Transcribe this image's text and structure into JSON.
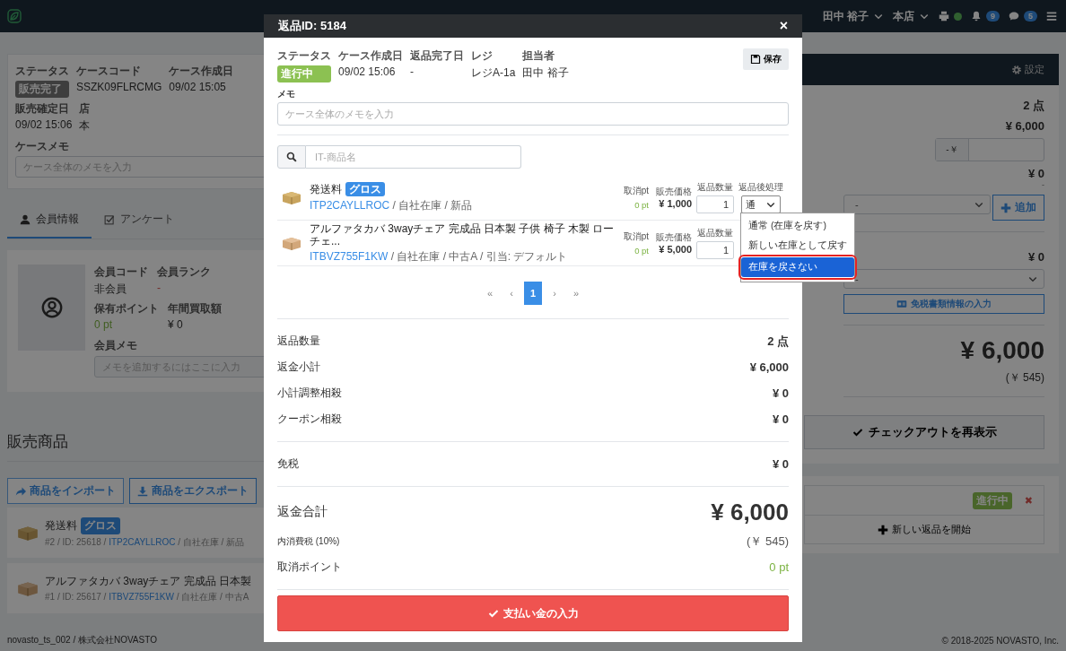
{
  "navbar": {
    "user": "田中 裕子",
    "store": "本店",
    "notifications": "9",
    "messages": "5"
  },
  "case": {
    "fields": [
      {
        "label": "ステータス",
        "value": "販売完了",
        "kind": "badge"
      },
      {
        "label": "ケースコード",
        "value": "SSZK09FLRCMG",
        "kind": "text"
      },
      {
        "label": "ケース作成日",
        "value": "09/02 15:05",
        "kind": "text"
      },
      {
        "label": "販売確定日",
        "value": "09/02 15:06",
        "kind": "text"
      },
      {
        "label": "店",
        "value": "本",
        "kind": "text"
      }
    ],
    "memo_label": "ケースメモ",
    "memo_placeholder": "ケース全体のメモを入力"
  },
  "tabs": [
    {
      "label": "会員情報",
      "selected": true
    },
    {
      "label": "アンケート",
      "selected": false
    }
  ],
  "member": {
    "fields": [
      {
        "label": "会員コード",
        "value": "非会員",
        "kind": "text"
      },
      {
        "label": "会員ランク",
        "value": "-",
        "kind": "danger"
      },
      {
        "label": "保有ポイント",
        "value": "0 pt",
        "kind": "points"
      },
      {
        "label": "年間買取額",
        "value": "¥ 0",
        "kind": "text"
      }
    ],
    "memo_label": "会員メモ",
    "memo_placeholder": "メモを追加するにはここに入力"
  },
  "sales": {
    "heading": "販売商品",
    "import_button": "商品をインポート",
    "export_button": "商品をエクスポート",
    "items": [
      {
        "name": "発送料",
        "badge": "グロス",
        "prefix": "#2 / ID: 25618 / ",
        "code": "ITP2CAYLLROC",
        "suffix": " / 自社在庫 / 新品"
      },
      {
        "name": "アルファタカバ 3wayチェア 完成品 日本製",
        "prefix": "#1 / ID: 25617 / ",
        "code": "ITBVZ755F1KW",
        "suffix": " / 自社在庫 / 中古A"
      }
    ]
  },
  "checkout": {
    "settings": "設定",
    "quantity": "2 点",
    "subtotal": "¥ 6,000",
    "adjust_prefix": "-￥",
    "coupon_amount": "¥ 0",
    "coupon_note": "-",
    "coupon_select": "-",
    "add_button": "追加",
    "tax_free_amount": "¥ 0",
    "tax_free_select": "-",
    "tax_free_button": "免税書類情報の入力",
    "total": "¥ 6,000",
    "tax": "(￥ 545)",
    "checkout_button": "チェックアウトを再表示",
    "return_status": "進行中",
    "remove": "✖",
    "new_return_button": "新しい返品を開始"
  },
  "footer": {
    "left": "novasto_ts_002 / 株式会社NOVASTO",
    "right": "© 2018-2025 NOVASTO, Inc."
  },
  "modal": {
    "title": "返品ID: 5184",
    "close": "×",
    "fields": [
      {
        "label": "ステータス",
        "value": "進行中",
        "kind": "badge"
      },
      {
        "label": "ケース作成日",
        "value": "09/02 15:06",
        "kind": "text"
      },
      {
        "label": "返品完了日",
        "value": "-",
        "kind": "text"
      },
      {
        "label": "レジ",
        "value": "レジA-1a",
        "kind": "text"
      },
      {
        "label": "担当者",
        "value": "田中 裕子",
        "kind": "text"
      }
    ],
    "save_button": "保存",
    "memo_label": "メモ",
    "memo_placeholder": "ケース全体のメモを入力",
    "search_placeholder": "IT-商品名",
    "items": [
      {
        "name": "発送料",
        "badge": "グロス",
        "code": "ITP2CAYLLROC",
        "meta": " / 自社在庫 / 新品",
        "cancel_pt_label": "取消pt",
        "cancel_pt": "0 pt",
        "price_label": "販売価格",
        "price": "¥ 1,000",
        "qty_label": "返品数量",
        "qty": "1",
        "action_label": "返品後処理",
        "action_value": "通",
        "options": [
          {
            "label": "通常 (在庫を戻す)",
            "selected": false
          },
          {
            "label": "新しい在庫として戻す",
            "selected": false
          },
          {
            "label": "在庫を戻さない",
            "selected": true
          }
        ]
      },
      {
        "name": "アルファタカバ 3wayチェア 完成品 日本製 子供 椅子 木製 ローチェ...",
        "code": "ITBVZ755F1KW",
        "meta": " / 自社在庫 / 中古A / 引当: デフォルト",
        "cancel_pt_label": "取消pt",
        "cancel_pt": "0 pt",
        "price_label": "販売価格",
        "price": "¥ 5,000",
        "qty_label": "返品数量",
        "qty": "1"
      }
    ],
    "pages": [
      {
        "label": "«",
        "selected": false
      },
      {
        "label": "‹",
        "selected": false
      },
      {
        "label": "1",
        "selected": true
      },
      {
        "label": "›",
        "selected": false
      },
      {
        "label": "»",
        "selected": false
      }
    ],
    "summary": [
      {
        "rows": [
          {
            "label": "返品数量",
            "value": "2 点",
            "kind": "normal"
          },
          {
            "label": "返金小計",
            "value": "¥ 6,000",
            "kind": "normal"
          },
          {
            "label": "小計調整相殺",
            "value": "¥ 0",
            "kind": "normal"
          },
          {
            "label": "クーポン相殺",
            "value": "¥ 0",
            "kind": "normal"
          }
        ]
      },
      {
        "rows": [
          {
            "label": "免税",
            "value": "¥ 0",
            "kind": "normal"
          }
        ]
      },
      {
        "rows": [
          {
            "label": "返金合計",
            "value": "¥ 6,000",
            "kind": "total"
          },
          {
            "label": "内消費税 (10%)",
            "value": "(￥ 545)",
            "kind": "muted"
          },
          {
            "label": "取消ポイント",
            "value": "0 pt",
            "kind": "points"
          }
        ]
      }
    ],
    "payment_button": "支払い金の入力"
  }
}
